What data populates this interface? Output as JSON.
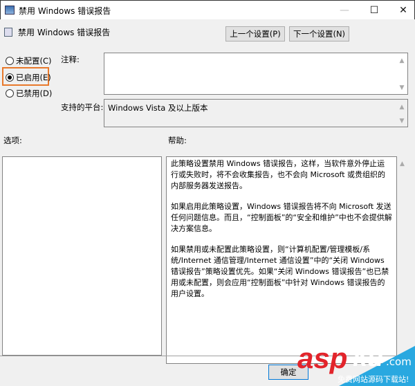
{
  "window": {
    "title": "禁用 Windows 错误报告",
    "minimize": "—",
    "maximize": "☐",
    "close": "✕"
  },
  "header": {
    "title": "禁用 Windows 错误报告",
    "prev_button": "上一个设置(P)",
    "next_button": "下一个设置(N)"
  },
  "state": {
    "options": [
      "未配置(C)",
      "已启用(E)",
      "已禁用(D)"
    ],
    "selected": "已启用(E)",
    "highlight_color": "#e8782a"
  },
  "comment": {
    "label": "注释:",
    "value": ""
  },
  "platform": {
    "label": "支持的平台:",
    "value": "Windows Vista 及以上版本"
  },
  "options_label": "选项:",
  "help": {
    "label": "帮助:",
    "paragraphs": [
      "此策略设置禁用 Windows 错误报告，这样，当软件意外停止运行或失败时，将不会收集报告，也不会向 Microsoft 或贵组织的内部服务器发送报告。",
      "如果启用此策略设置，Windows 错误报告将不向 Microsoft 发送任何问题信息。而且，“控制面板”的“安全和维护”中也不会提供解决方案信息。",
      "如果禁用或未配置此策略设置，则“计算机配置/管理模板/系统/Internet 通信管理/Internet 通信设置”中的“关闭 Windows 错误报告”策略设置优先。如果“关闭 Windows 错误报告”也已禁用或未配置，则会应用“控制面板”中针对 Windows 错误报告的用户设置。"
    ]
  },
  "footer": {
    "ok_button": "确定"
  },
  "watermark": {
    "brand": "asp",
    "brand2": "ku",
    ".com": ".com",
    "tagline": "免费网站源码下载站!"
  }
}
